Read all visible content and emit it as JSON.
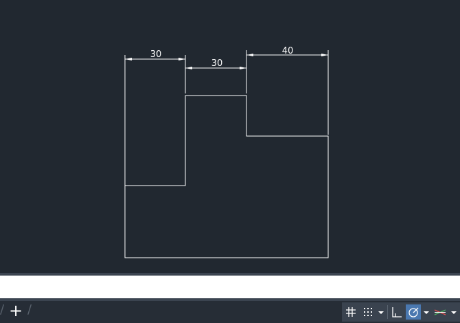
{
  "drawing": {
    "dimensions": {
      "left_width": "30",
      "middle_width": "30",
      "right_width": "40"
    }
  },
  "command_line": {
    "value": "",
    "placeholder": ""
  },
  "status_bar": {
    "layout_tabs_separator": "/",
    "add_layout_label": "+",
    "tools": [
      {
        "name": "grid-display-icon",
        "active": false
      },
      {
        "name": "snap-mode-icon",
        "active": false
      },
      {
        "name": "snap-mode-dropdown",
        "active": false
      },
      {
        "name": "ortho-mode-icon",
        "active": false
      },
      {
        "name": "polar-tracking-icon",
        "active": true
      },
      {
        "name": "polar-tracking-dropdown",
        "active": false
      },
      {
        "name": "isometric-drafting-icon",
        "active": false
      },
      {
        "name": "isometric-drafting-dropdown",
        "active": false
      }
    ]
  },
  "colors": {
    "canvas_background": "#212830",
    "geometry_line": "#ffffff",
    "command_line_background": "#ffffff",
    "status_bar_background": "#262d36",
    "active_tool_highlight": "#4a78b0"
  }
}
